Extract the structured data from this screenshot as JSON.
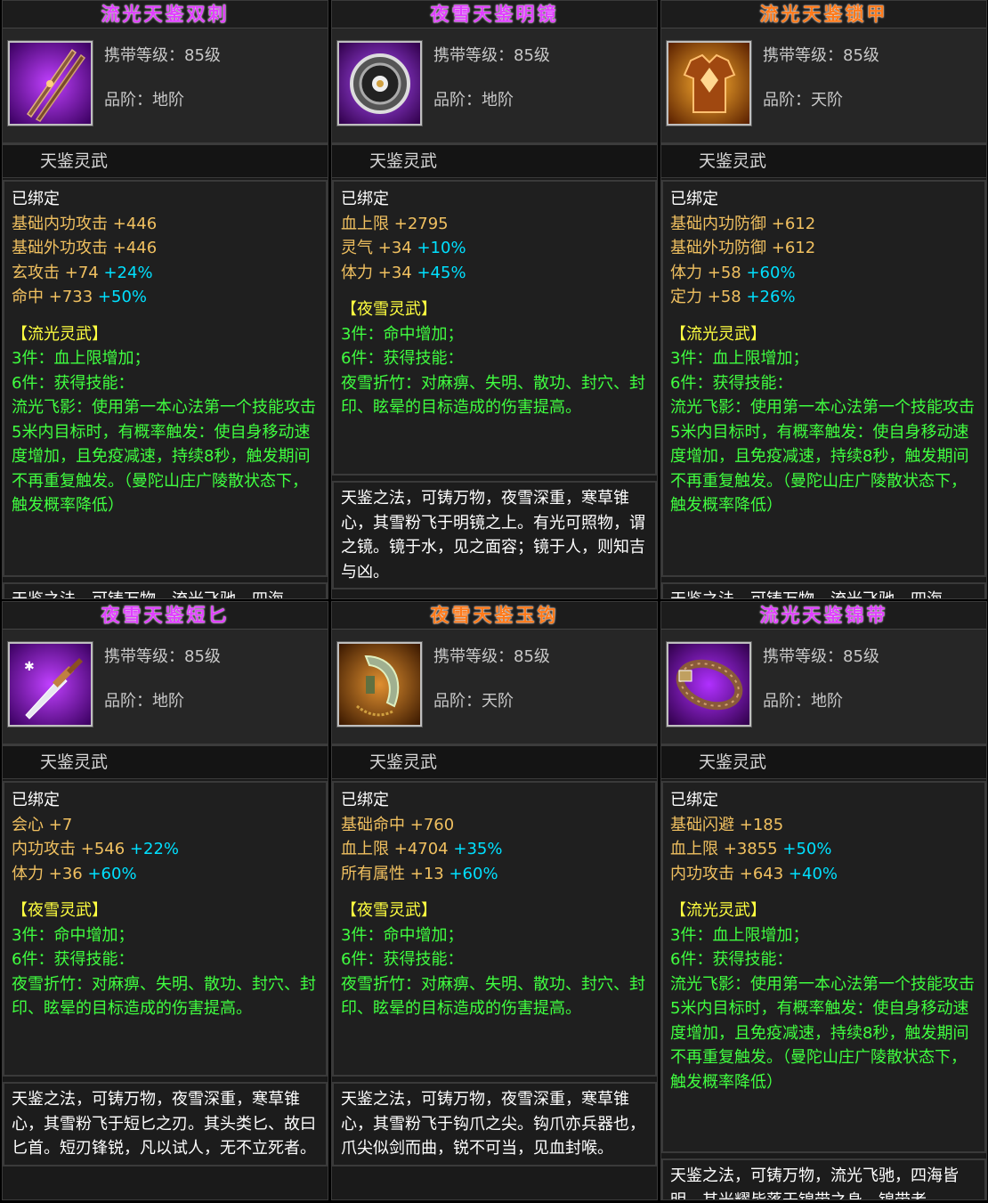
{
  "cards": [
    {
      "title": "流光天鉴双刺",
      "level": "携带等级：85级",
      "grade": "品阶：地阶",
      "subtitle": "天鉴灵武",
      "bound": "已绑定",
      "stats": [
        {
          "name": "基础内功攻击",
          "value": "+446",
          "pct": ""
        },
        {
          "name": "基础外功攻击",
          "value": "+446",
          "pct": ""
        },
        {
          "name": "玄攻击",
          "value": "+74",
          "pct": "+24%"
        },
        {
          "name": "命中",
          "value": "+733",
          "pct": "+50%"
        }
      ],
      "set_name": "【流光灵武】",
      "set3": "3件：血上限增加；",
      "set6": "6件：获得技能：",
      "skill": "流光飞影：使用第一本心法第一个技能攻击5米内目标时，有概率触发：使自身移动速度增加，且免疫减速，持续8秒，触发期间不再重复触发。（曼陀山庄广陵散状态下，触发概率降低）",
      "lore": "天鉴之法，可铸万物，流光飞驰，四海"
    },
    {
      "title": "夜雪天鉴明镜",
      "level": "携带等级：85级",
      "grade": "品阶：地阶",
      "subtitle": "天鉴灵武",
      "bound": "已绑定",
      "stats": [
        {
          "name": "血上限",
          "value": "+2795",
          "pct": ""
        },
        {
          "name": "灵气",
          "value": "+34",
          "pct": "+10%"
        },
        {
          "name": "体力",
          "value": "+34",
          "pct": "+45%"
        }
      ],
      "set_name": "【夜雪灵武】",
      "set3": "3件：命中增加；",
      "set6": "6件：获得技能：",
      "skill": "夜雪折竹：对麻痹、失明、散功、封穴、封印、眩晕的目标造成的伤害提高。",
      "lore": "天鉴之法，可铸万物，夜雪深重，寒草锥心，其雪粉飞于明镜之上。有光可照物，谓之镜。镜于水，见之面容；镜于人，则知吉与凶。"
    },
    {
      "title": "流光天鉴锁甲",
      "level": "携带等级：85级",
      "grade": "品阶：天阶",
      "subtitle": "天鉴灵武",
      "bound": "已绑定",
      "stats": [
        {
          "name": "基础内功防御",
          "value": "+612",
          "pct": ""
        },
        {
          "name": "基础外功防御",
          "value": "+612",
          "pct": ""
        },
        {
          "name": "体力",
          "value": "+58",
          "pct": "+60%"
        },
        {
          "name": "定力",
          "value": "+58",
          "pct": "+26%"
        }
      ],
      "set_name": "【流光灵武】",
      "set3": "3件：血上限增加；",
      "set6": "6件：获得技能：",
      "skill": "流光飞影：使用第一本心法第一个技能攻击5米内目标时，有概率触发：使自身移动速度增加，且免疫减速，持续8秒，触发期间不再重复触发。（曼陀山庄广陵散状态下，触发概率降低）",
      "lore": "天鉴之法，可铸万物，流光飞驰，四海"
    },
    {
      "title": "夜雪天鉴短匕",
      "level": "携带等级：85级",
      "grade": "品阶：地阶",
      "subtitle": "天鉴灵武",
      "bound": "已绑定",
      "stats": [
        {
          "name": "会心",
          "value": "+7",
          "pct": ""
        },
        {
          "name": "内功攻击",
          "value": "+546",
          "pct": "+22%"
        },
        {
          "name": "体力",
          "value": "+36",
          "pct": "+60%"
        }
      ],
      "set_name": "【夜雪灵武】",
      "set3": "3件：命中增加；",
      "set6": "6件：获得技能：",
      "skill": "夜雪折竹：对麻痹、失明、散功、封穴、封印、眩晕的目标造成的伤害提高。",
      "lore": "天鉴之法，可铸万物，夜雪深重，寒草锥心，其雪粉飞于短匕之刃。其头类匕、故曰匕首。短刃锋锐，凡以试人，无不立死者。"
    },
    {
      "title": "夜雪天鉴玉钩",
      "level": "携带等级：85级",
      "grade": "品阶：天阶",
      "subtitle": "天鉴灵武",
      "bound": "已绑定",
      "stats": [
        {
          "name": "基础命中",
          "value": "+760",
          "pct": ""
        },
        {
          "name": "血上限",
          "value": "+4704",
          "pct": "+35%"
        },
        {
          "name": "所有属性",
          "value": "+13",
          "pct": "+60%"
        }
      ],
      "set_name": "【夜雪灵武】",
      "set3": "3件：命中增加；",
      "set6": "6件：获得技能：",
      "skill": "夜雪折竹：对麻痹、失明、散功、封穴、封印、眩晕的目标造成的伤害提高。",
      "lore": "天鉴之法，可铸万物，夜雪深重，寒草锥心，其雪粉飞于钩爪之尖。钩爪亦兵器也，爪尖似剑而曲，锐不可当，见血封喉。"
    },
    {
      "title": "流光天鉴锦带",
      "level": "携带等级：85级",
      "grade": "品阶：地阶",
      "subtitle": "天鉴灵武",
      "bound": "已绑定",
      "stats": [
        {
          "name": "基础闪避",
          "value": "+185",
          "pct": ""
        },
        {
          "name": "血上限",
          "value": "+3855",
          "pct": "+50%"
        },
        {
          "name": "内功攻击",
          "value": "+643",
          "pct": "+40%"
        }
      ],
      "set_name": "【流光灵武】",
      "set3": "3件：血上限增加；",
      "set6": "6件：获得技能：",
      "skill": "流光飞影：使用第一本心法第一个技能攻击5米内目标时，有概率触发：使自身移动速度增加，且免疫减速，持续8秒，触发期间不再重复触发。（曼陀山庄广陵散状态下，触发概率降低）",
      "lore": "天鉴之法，可铸万物，流光飞驰，四海皆明，其光耀皆落于锦带之身。锦带者"
    }
  ],
  "colors": {
    "title_pink": "#e040ff",
    "title_orange": "#ff7a1a",
    "stat": "#f0c060",
    "pct": "#00e0ff",
    "set_title": "#ffff40",
    "set_text": "#40ff40"
  },
  "icons": [
    "twin-daggers-icon",
    "mirror-icon",
    "armor-icon",
    "dagger-icon",
    "jade-hook-icon",
    "belt-icon"
  ]
}
